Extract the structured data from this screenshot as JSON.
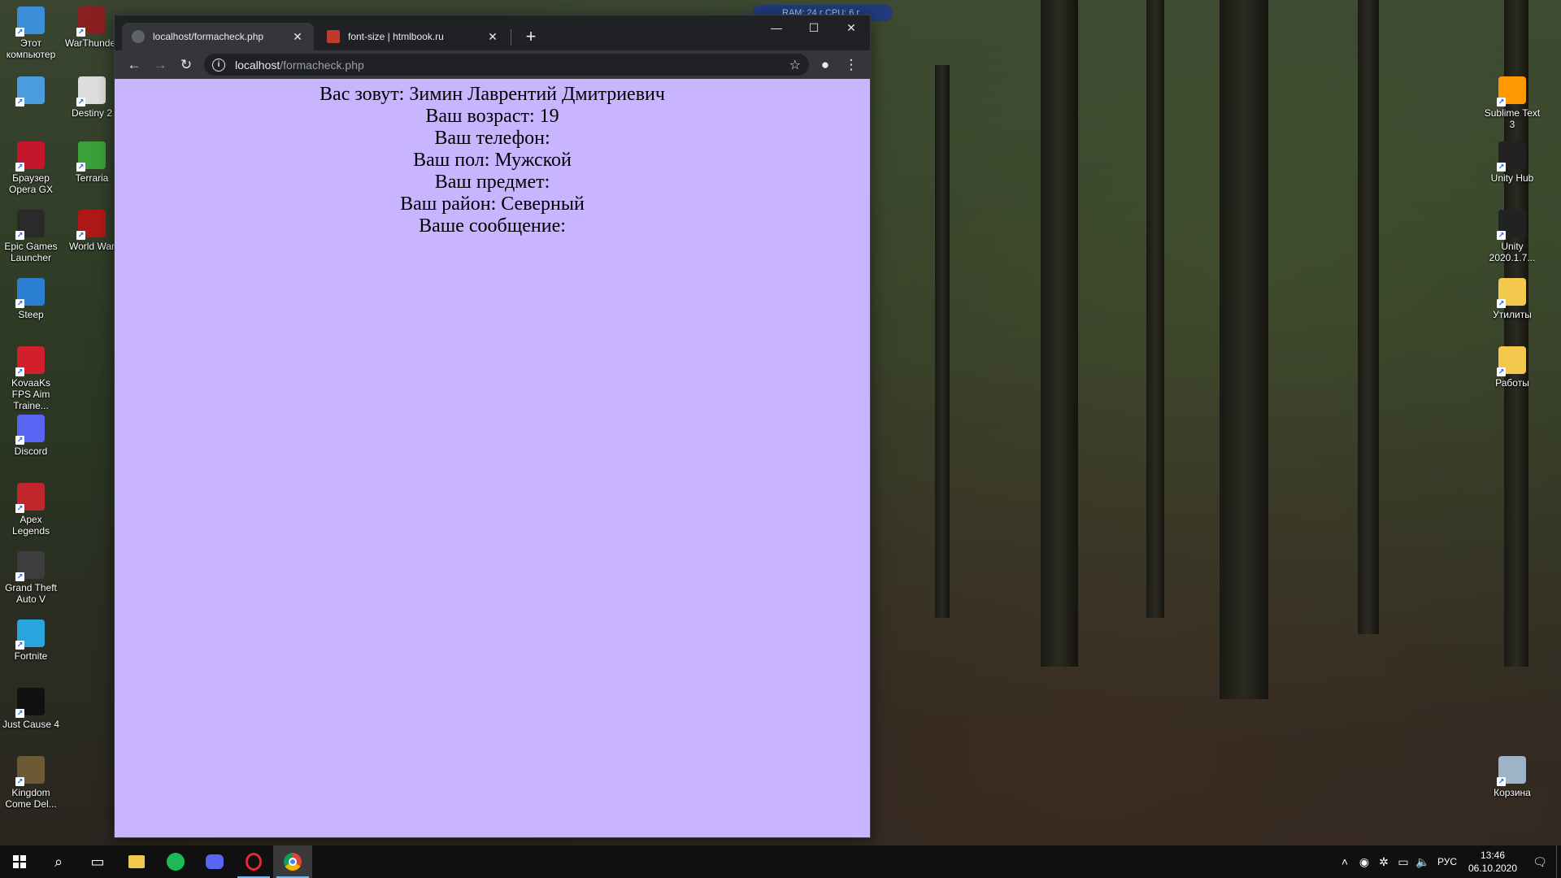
{
  "desktop": {
    "left_icons_col1": [
      {
        "label": "Этот компьютер",
        "icon": "this-pc-icon",
        "color": "#3b8fd6"
      },
      {
        "label": "",
        "icon": "control-panel-icon",
        "color": "#4a9be0"
      },
      {
        "label": "Браузер Opera GX",
        "icon": "opera-gx-icon",
        "color": "#c4162a"
      },
      {
        "label": "Epic Games Launcher",
        "icon": "epic-games-icon",
        "color": "#2a2a2a"
      },
      {
        "label": "Steep",
        "icon": "steep-icon",
        "color": "#2b7fd3"
      },
      {
        "label": "KovaaKs FPS Aim Traine...",
        "icon": "kovaaks-icon",
        "color": "#d21f2b"
      },
      {
        "label": "Discord",
        "icon": "discord-icon",
        "color": "#5865f2"
      },
      {
        "label": "Apex Legends",
        "icon": "apex-legends-icon",
        "color": "#c0262c"
      },
      {
        "label": "Grand Theft Auto V",
        "icon": "gta-v-icon",
        "color": "#3d3d3d"
      },
      {
        "label": "Fortnite",
        "icon": "fortnite-icon",
        "color": "#2aa4dc"
      },
      {
        "label": "Just Cause 4",
        "icon": "just-cause-4-icon",
        "color": "#111111"
      },
      {
        "label": "Kingdom Come Del...",
        "icon": "kingdom-come-icon",
        "color": "#6d5a34"
      }
    ],
    "left_icons_col2": [
      {
        "label": "WarThunder",
        "icon": "warthunder-icon",
        "color": "#8a1f1f"
      },
      {
        "label": "Destiny 2",
        "icon": "destiny-2-icon",
        "color": "#dddddd"
      },
      {
        "label": "Terraria",
        "icon": "terraria-icon",
        "color": "#3aa13a"
      },
      {
        "label": "World War",
        "icon": "world-war-z-icon",
        "color": "#b01818"
      }
    ],
    "right_icons": [
      {
        "label": "Sublime Text 3",
        "icon": "sublime-text-icon",
        "color": "#ff9800"
      },
      {
        "label": "Unity Hub",
        "icon": "unity-hub-icon",
        "color": "#222222"
      },
      {
        "label": "Unity 2020.1.7...",
        "icon": "unity-icon",
        "color": "#222222"
      },
      {
        "label": "Утилиты",
        "icon": "folder-icon",
        "color": "#f2c94c"
      },
      {
        "label": "Работы",
        "icon": "folder-icon",
        "color": "#f2c94c"
      },
      {
        "label": "Корзина",
        "icon": "recycle-bin-icon",
        "color": "#9fb3c8"
      }
    ],
    "overlay_text": "RAM: 24 г CPU: 6 г"
  },
  "browser": {
    "tabs": [
      {
        "title": "localhost/formacheck.php",
        "active": true
      },
      {
        "title": "font-size | htmlbook.ru",
        "active": false
      }
    ],
    "address": {
      "host": "localhost",
      "path": "/formacheck.php"
    },
    "page_lines": [
      "Вас зовут: Зимин Лаврентий Дмитриевич",
      "Ваш возраст: 19",
      "Ваш телефон:",
      "Ваш пол: Мужской",
      "Ваш предмет:",
      "Ваш район: Северный",
      "Ваше сообщение:"
    ],
    "page_bg": "#c8b4ff"
  },
  "taskbar": {
    "lang": "РУС",
    "time": "13:46",
    "date": "06.10.2020"
  }
}
